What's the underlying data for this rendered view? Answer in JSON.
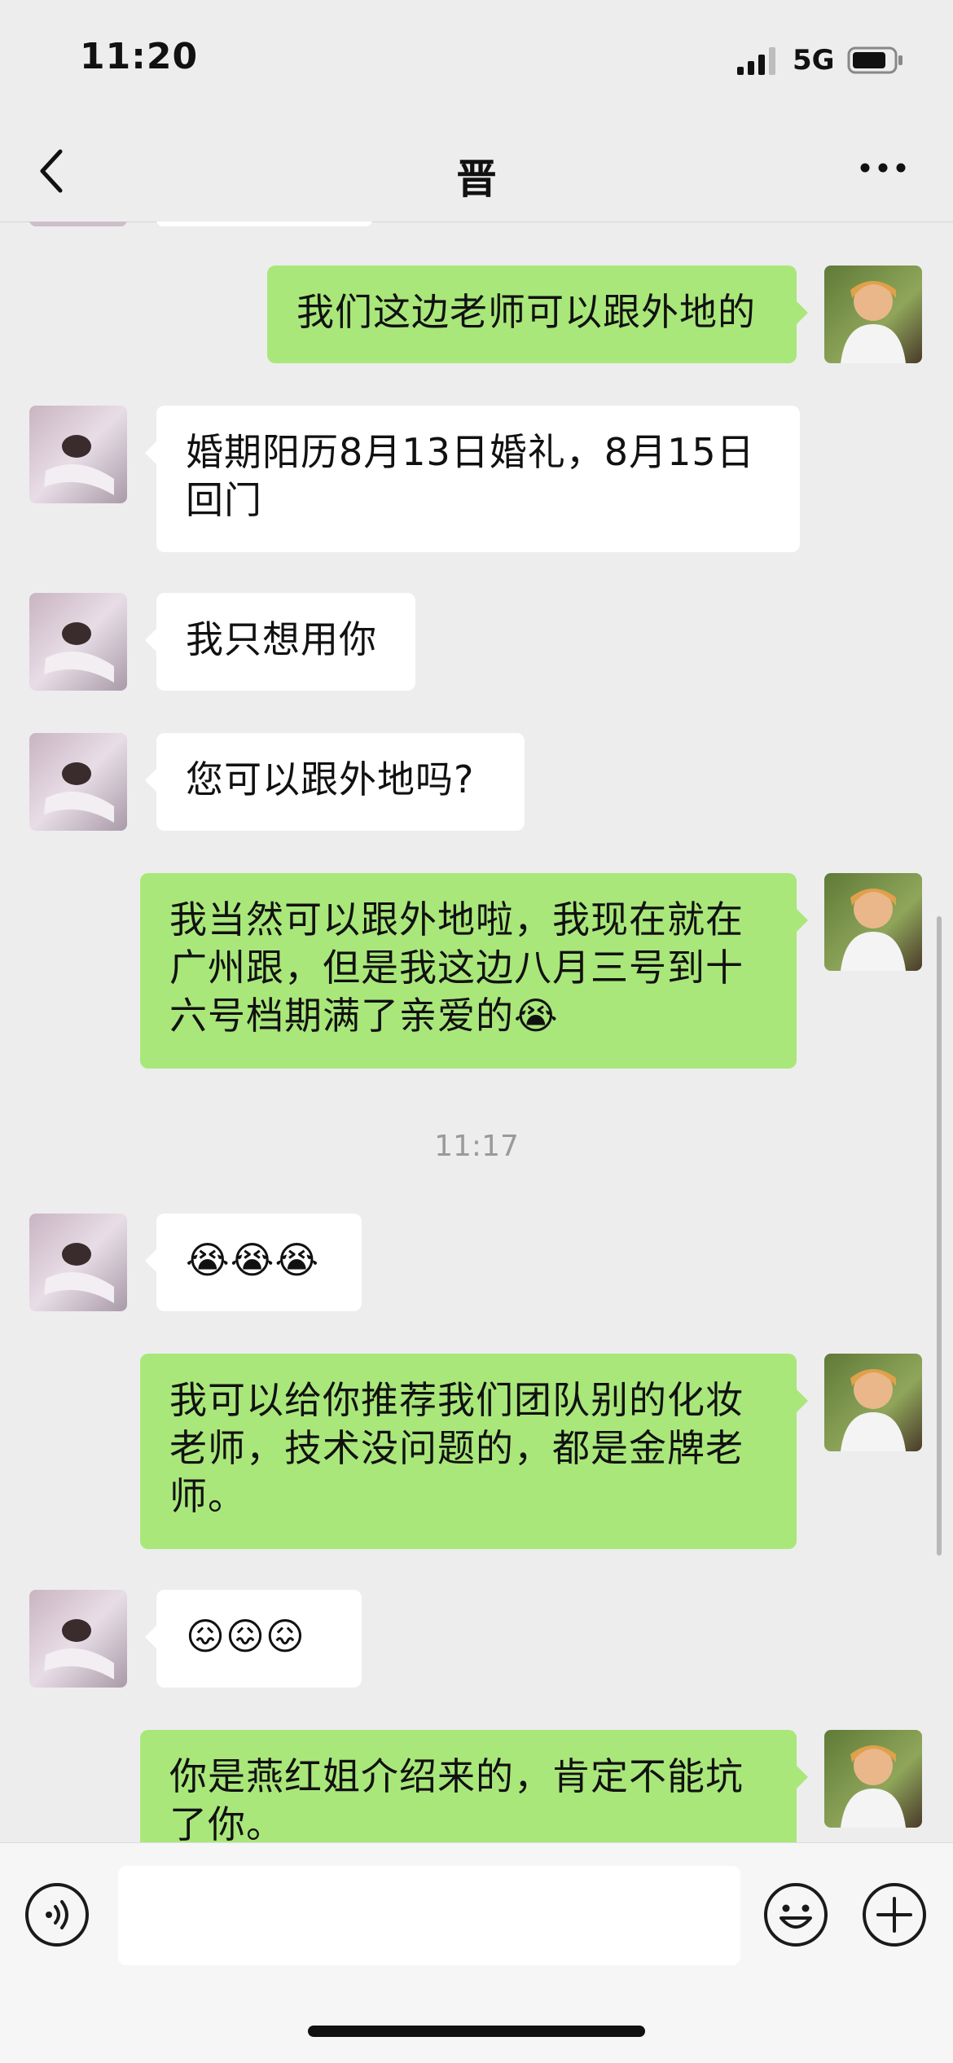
{
  "status_bar": {
    "time": "11:20",
    "network": "5G"
  },
  "header": {
    "title": "晋"
  },
  "messages": [
    {
      "side": "out",
      "text": "我们这边老师可以跟外地的"
    },
    {
      "side": "in",
      "text": "婚期阳历8月13日婚礼，8月15日\n回门"
    },
    {
      "side": "in",
      "text": "我只想用你"
    },
    {
      "side": "in",
      "text": "您可以跟外地吗?"
    },
    {
      "side": "out",
      "text": "我当然可以跟外地啦，我现在就在\n广州跟，但是我这边八月三号到十\n六号档期满了亲爱的😭"
    },
    {
      "side": "in",
      "text": "😭😭😭"
    },
    {
      "side": "out",
      "text": "我可以给你推荐我们团队别的化妆\n老师，技术没问题的，都是金牌老\n师。"
    },
    {
      "side": "in",
      "text": "😖😖😖"
    },
    {
      "side": "out",
      "text": "你是燕红姐介绍来的，肯定不能坑\n了你。"
    }
  ],
  "timestamp": "11:17",
  "input": {
    "value": "",
    "placeholder": ""
  },
  "colors": {
    "background": "#ededed",
    "outgoing_bubble": "#a9e77a",
    "incoming_bubble": "#ffffff"
  },
  "icons": [
    "back-chevron-icon",
    "more-dots-icon",
    "voice-icon",
    "emoji-icon",
    "plus-icon"
  ]
}
